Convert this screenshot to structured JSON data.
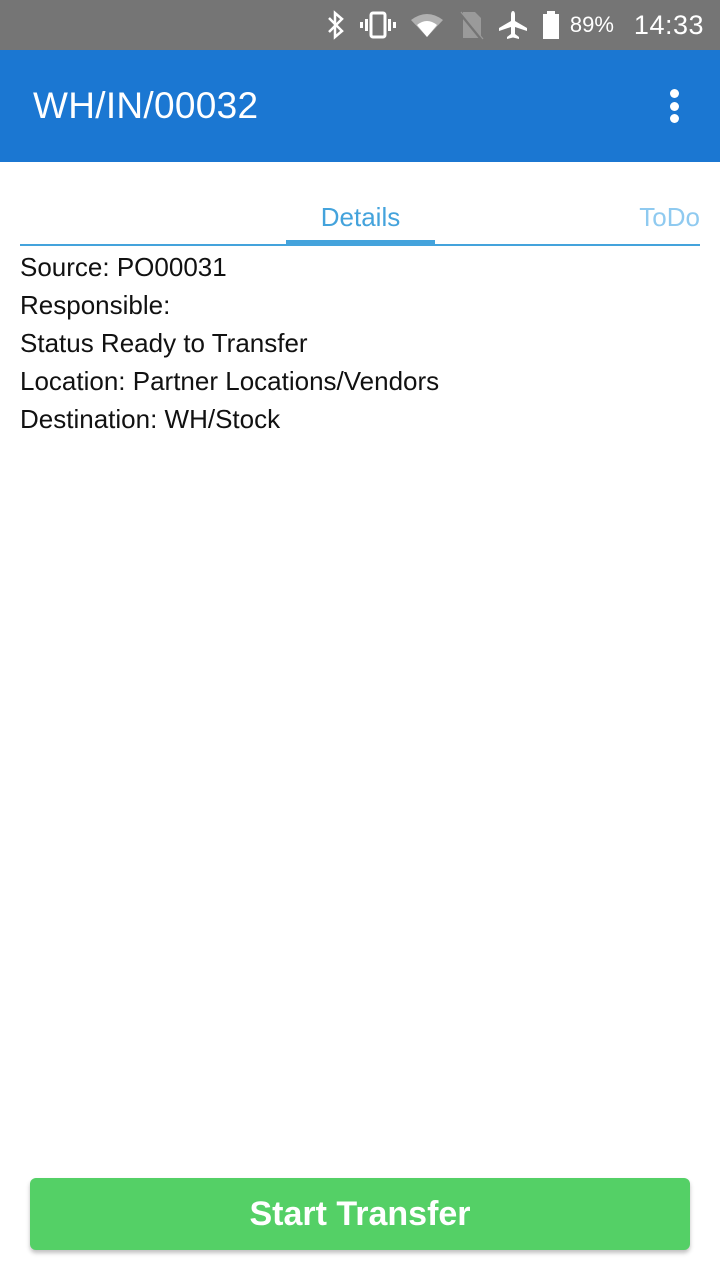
{
  "status_bar": {
    "icons": [
      "bluetooth-icon",
      "vibrate-icon",
      "wifi-icon",
      "no-sim-icon",
      "airplane-mode-icon",
      "battery-icon"
    ],
    "battery_percent": "89%",
    "time": "14:33"
  },
  "app_bar": {
    "title": "WH/IN/00032",
    "overflow_icon": "more-vert-icon"
  },
  "tabs": [
    {
      "label": "Details",
      "selected": true
    },
    {
      "label": "ToDo",
      "selected": false
    }
  ],
  "details": {
    "source": "Source: PO00031",
    "responsible": "Responsible:",
    "status": "Status Ready to Transfer",
    "location": "Location: Partner Locations/Vendors",
    "destination": "Destination: WH/Stock"
  },
  "actions": {
    "start_transfer_label": "Start Transfer"
  },
  "colors": {
    "app_bar": "#1b77d2",
    "status_bar": "#757575",
    "tab_accent": "#44a3dc",
    "primary_button": "#54d066"
  }
}
